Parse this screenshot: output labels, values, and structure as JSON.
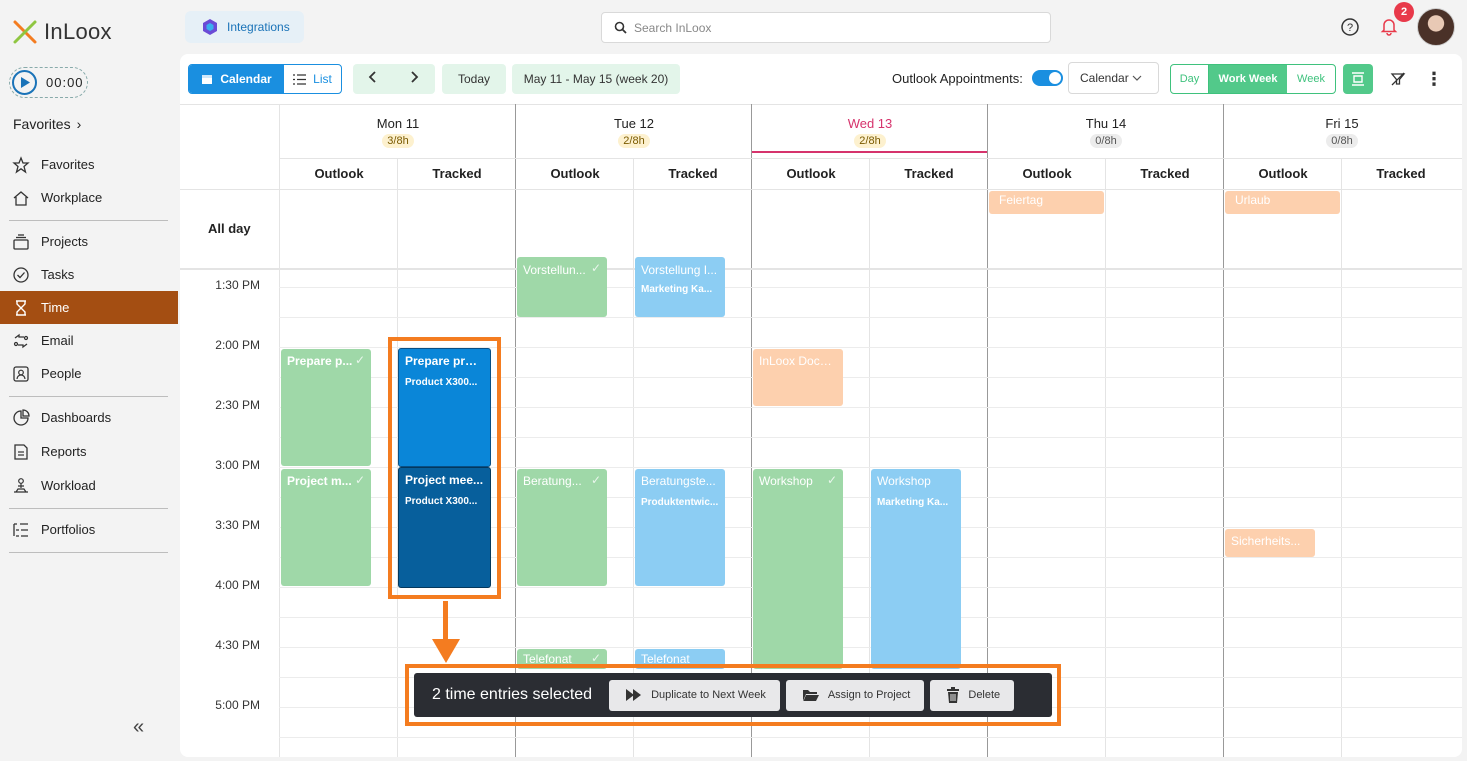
{
  "app": {
    "logo_text": "InLoox"
  },
  "header": {
    "integrations_label": "Integrations",
    "search_placeholder": "Search InLoox",
    "notification_count": "2"
  },
  "sidebar": {
    "timer": "00:00",
    "favorites_heading": "Favorites",
    "items": [
      {
        "label": "Favorites",
        "icon": "star-icon"
      },
      {
        "label": "Workplace",
        "icon": "home-icon"
      },
      {
        "label": "Projects",
        "icon": "projects-icon"
      },
      {
        "label": "Tasks",
        "icon": "check-circle-icon"
      },
      {
        "label": "Time",
        "icon": "hourglass-icon",
        "active": true
      },
      {
        "label": "Email",
        "icon": "email-icon"
      },
      {
        "label": "People",
        "icon": "people-icon"
      },
      {
        "label": "Dashboards",
        "icon": "pie-chart-icon"
      },
      {
        "label": "Reports",
        "icon": "report-icon"
      },
      {
        "label": "Workload",
        "icon": "workload-icon"
      },
      {
        "label": "Portfolios",
        "icon": "portfolio-icon"
      }
    ],
    "collapse_label": "«"
  },
  "toolbar": {
    "calendar_label": "Calendar",
    "list_label": "List",
    "today_label": "Today",
    "date_range": "May 11 - May 15 (week 20)",
    "outlook_label": "Outlook Appointments:",
    "outlook_enabled": true,
    "view_select": "Calendar",
    "view_day": "Day",
    "view_work_week": "Work Week",
    "view_week": "Week"
  },
  "calendar": {
    "all_day_label": "All day",
    "sub_columns": [
      "Outlook",
      "Tracked"
    ],
    "days": [
      {
        "label": "Mon 11",
        "hours": "3/8h",
        "hours_style": "warn"
      },
      {
        "label": "Tue 12",
        "hours": "2/8h",
        "hours_style": "warn"
      },
      {
        "label": "Wed 13",
        "hours": "2/8h",
        "hours_style": "warn",
        "today": true
      },
      {
        "label": "Thu 14",
        "hours": "0/8h",
        "hours_style": "zero"
      },
      {
        "label": "Fri 15",
        "hours": "0/8h",
        "hours_style": "zero"
      }
    ],
    "time_labels": [
      "1:30 PM",
      "2:00 PM",
      "2:30 PM",
      "3:00 PM",
      "3:30 PM",
      "4:00 PM",
      "4:30 PM",
      "5:00 PM"
    ],
    "all_day_events": [
      {
        "title": "Feiertag"
      },
      {
        "title": "Urlaub"
      }
    ],
    "events": [
      {
        "title": "Vorstellun...",
        "subtitle": ""
      },
      {
        "title": "Vorstellung I...",
        "subtitle": "Marketing Ka..."
      },
      {
        "title": "Prepare p...",
        "subtitle": ""
      },
      {
        "title": "Prepare proj...",
        "subtitle": "Product X300..."
      },
      {
        "title": "InLoox Docs ...",
        "subtitle": ""
      },
      {
        "title": "Project m...",
        "subtitle": ""
      },
      {
        "title": "Project mee...",
        "subtitle": "Product X300..."
      },
      {
        "title": "Beratung...",
        "subtitle": ""
      },
      {
        "title": "Beratungste...",
        "subtitle": "Produktentwic..."
      },
      {
        "title": "Workshop",
        "subtitle": ""
      },
      {
        "title": "Workshop",
        "subtitle": "Marketing Ka..."
      },
      {
        "title": "Sicherheits...",
        "subtitle": ""
      },
      {
        "title": "Telefonat",
        "subtitle": ""
      },
      {
        "title": "Telefonat",
        "subtitle": ""
      }
    ]
  },
  "selection_bar": {
    "count_text": "2 time entries selected",
    "duplicate_label": "Duplicate to Next Week",
    "assign_label": "Assign to Project",
    "delete_label": "Delete"
  },
  "colors": {
    "accent": "#1a8fe0",
    "active_nav": "#a44e12",
    "outlook_event": "#9fd8a8",
    "tracked_event": "#8ccdf3",
    "holiday_event": "#fdd0ae",
    "selected_event": "#0a86d8",
    "highlight": "#f47c20"
  }
}
